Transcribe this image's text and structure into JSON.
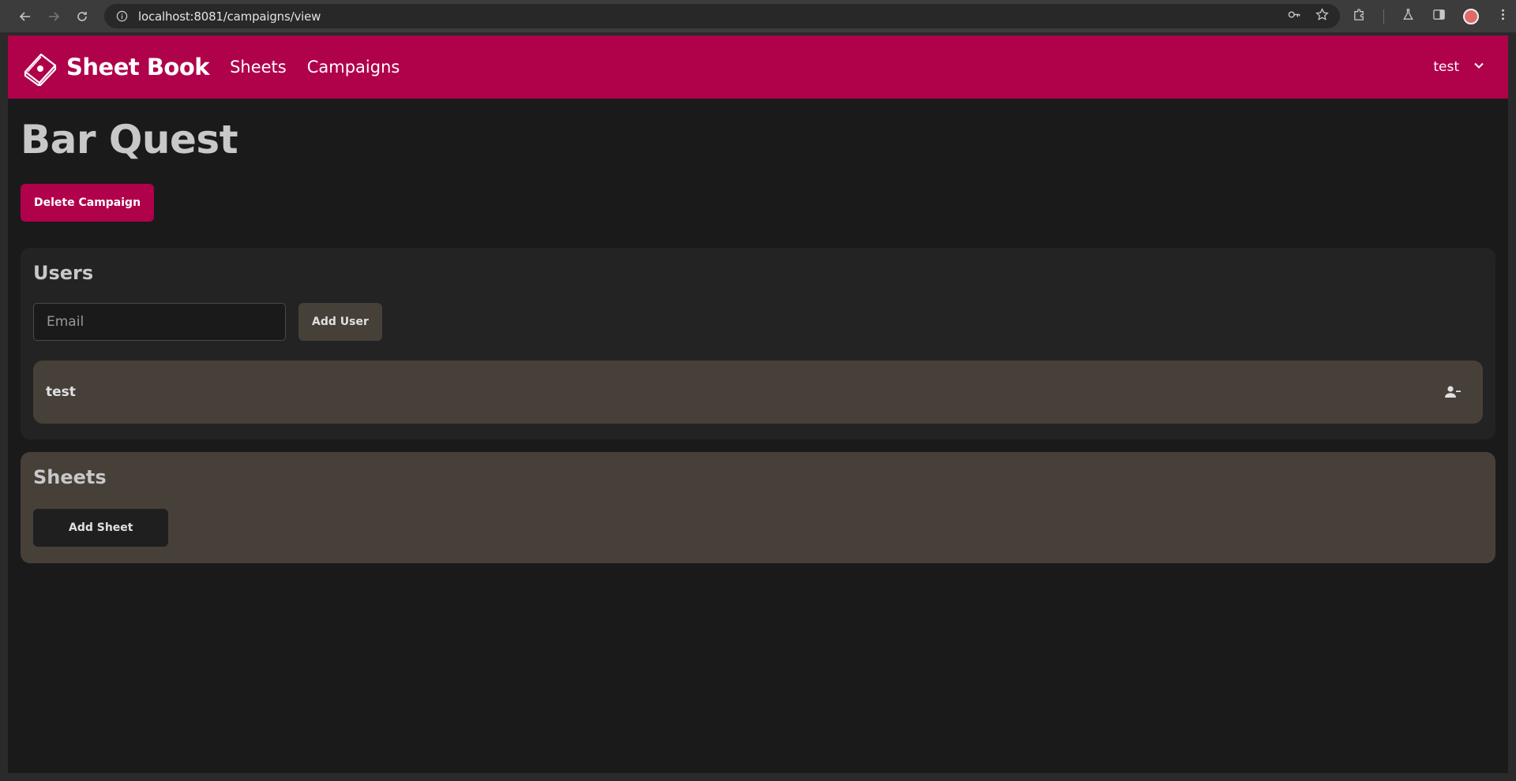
{
  "browser": {
    "url": "localhost:8081/campaigns/view"
  },
  "header": {
    "brand": "Sheet Book",
    "nav": [
      "Sheets",
      "Campaigns"
    ],
    "user": "test"
  },
  "page": {
    "title": "Bar Quest",
    "delete_button": "Delete Campaign"
  },
  "users": {
    "title": "Users",
    "email_placeholder": "Email",
    "add_button": "Add User",
    "list": [
      "test"
    ]
  },
  "sheets": {
    "title": "Sheets",
    "add_button": "Add Sheet"
  },
  "colors": {
    "brand": "#b0014b",
    "background": "#1a1a1a",
    "card": "#232323",
    "card_alt": "#464039"
  },
  "icons": {
    "logo": "book-icon",
    "user_menu": "chevron-down-icon",
    "remove_user": "person-remove-icon"
  }
}
